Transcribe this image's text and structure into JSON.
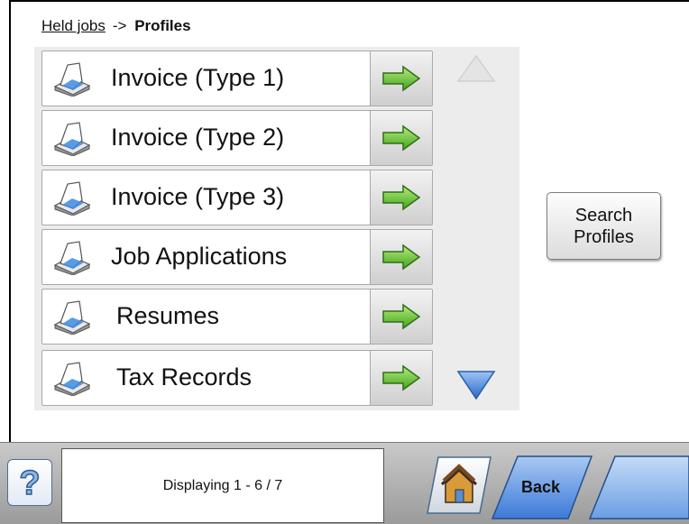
{
  "breadcrumb": {
    "parent": "Held jobs",
    "separator": "->",
    "current": "Profiles"
  },
  "profiles": [
    {
      "label": "Invoice (Type 1)"
    },
    {
      "label": "Invoice (Type 2)"
    },
    {
      "label": "Invoice (Type 3)"
    },
    {
      "label": "Job Applications"
    },
    {
      "label": "Resumes"
    },
    {
      "label": "Tax Records"
    }
  ],
  "search_button": {
    "line1": "Search",
    "line2": "Profiles"
  },
  "status": {
    "text": "Displaying 1 - 6 / 7"
  },
  "bottom_bar": {
    "help_icon": "question-mark-icon",
    "home_icon": "home-icon",
    "back_label": "Back"
  },
  "colors": {
    "arrow_green": "#5cb82c",
    "scroll_blue": "#3f7fd8",
    "list_bg": "#ececec"
  }
}
